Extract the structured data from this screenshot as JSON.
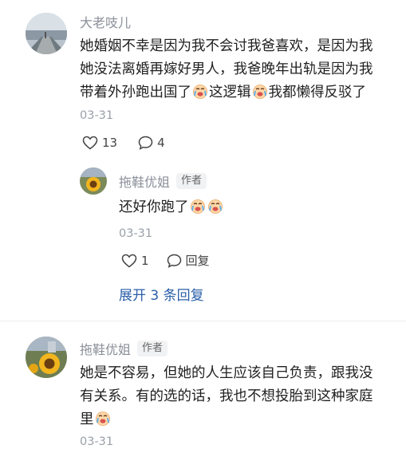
{
  "comments": [
    {
      "username": "大老吱儿",
      "text_parts": [
        "她婚姻不幸是因为我不会讨我爸喜欢，是因为我",
        "她没法离婚再嫁好男人，我爸晚年出轨是因为我",
        "带着外孙跑出国了",
        "这逻辑",
        "我都懒得反驳了"
      ],
      "date": "03-31",
      "likes": "13",
      "replies": "4"
    },
    {
      "username": "拖鞋优姐",
      "author_tag": "作者",
      "text": "还好你跑了",
      "date": "03-31",
      "likes": "1",
      "reply_label": "回复"
    },
    {
      "username": "拖鞋优姐",
      "author_tag": "作者",
      "text_lines": [
        "她是不容易，但她的人生应该自己负责，跟我没",
        "有关系。有的选的话，我也不想投胎到这种家庭",
        "里"
      ],
      "date": "03-31"
    }
  ],
  "expand_label": "展开 3 条回复",
  "icons": {
    "heart": "heart-icon",
    "comment": "comment-icon",
    "emoji": "crying-emoji-icon"
  },
  "colors": {
    "username": "#8a8f99",
    "link": "#2a5ea8",
    "date": "#9aa0a8"
  }
}
